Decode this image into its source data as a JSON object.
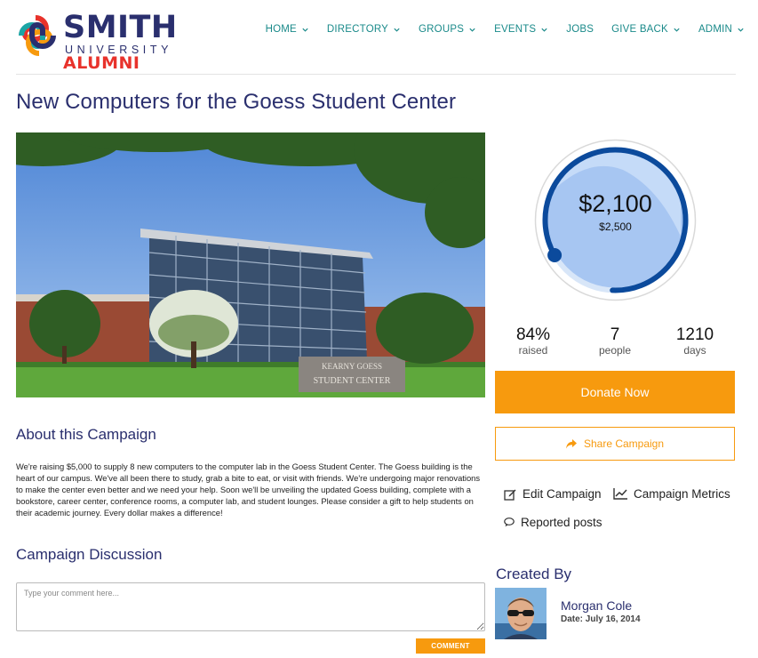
{
  "brand": {
    "name": "SMITH",
    "subtitle": "UNIVERSITY",
    "tagline": "ALUMNI",
    "colors": {
      "navy": "#2a2f6e",
      "red": "#e8322b",
      "orange": "#f79a0e",
      "teal": "#1a8a8a"
    }
  },
  "nav": {
    "items": [
      {
        "label": "HOME",
        "has_dropdown": true
      },
      {
        "label": "DIRECTORY",
        "has_dropdown": true
      },
      {
        "label": "GROUPS",
        "has_dropdown": true
      },
      {
        "label": "EVENTS",
        "has_dropdown": true
      },
      {
        "label": "JOBS",
        "has_dropdown": false
      },
      {
        "label": "GIVE BACK",
        "has_dropdown": true
      },
      {
        "label": "ADMIN",
        "has_dropdown": true
      }
    ]
  },
  "campaign": {
    "title": "New Computers for the Goess Student Center",
    "image_sign_text": [
      "KEARNY GOESS",
      "STUDENT CENTER"
    ],
    "raised_amount": "$2,100",
    "goal_amount": "$2,500",
    "progress_fraction": 0.84,
    "stats": [
      {
        "value": "84%",
        "label": "raised"
      },
      {
        "value": "7",
        "label": "people"
      },
      {
        "value": "1210",
        "label": "days"
      }
    ],
    "donate_label": "Donate Now",
    "share_label": "Share Campaign",
    "admin_links": {
      "edit": "Edit Campaign",
      "metrics": "Campaign Metrics",
      "reported": "Reported posts"
    },
    "about": {
      "heading": "About this Campaign",
      "text": "We're raising $5,000 to supply 8 new computers to the computer lab in the Goess Student Center. The Goess building is the heart of our campus. We've all been there to study, grab a bite to eat, or visit with friends. We're undergoing major renovations to make the center even better and we need your help. Soon we'll be unveiling the updated Goess building, complete with a bookstore, career center, conference rooms, a computer lab, and student lounges. Please consider a gift to help students on their academic journey. Every dollar makes a difference!"
    },
    "discussion": {
      "heading": "Campaign Discussion",
      "placeholder": "Type your comment here...",
      "value": "",
      "submit_label": "COMMENT"
    },
    "creator": {
      "heading": "Created By",
      "name": "Morgan Cole",
      "date_label": "Date:",
      "date": "July 16, 2014"
    }
  }
}
